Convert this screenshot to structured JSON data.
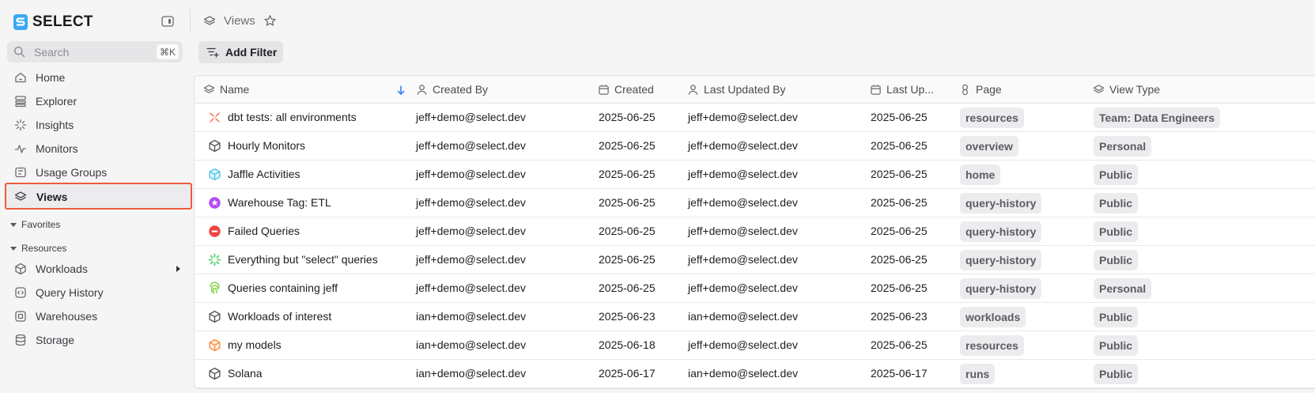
{
  "brand": {
    "name": "SELECT"
  },
  "sidebar": {
    "search": {
      "placeholder": "Search",
      "shortcut": "⌘K"
    },
    "items": [
      {
        "label": "Home",
        "icon": "home-icon"
      },
      {
        "label": "Explorer",
        "icon": "explorer-icon"
      },
      {
        "label": "Insights",
        "icon": "insights-icon"
      },
      {
        "label": "Monitors",
        "icon": "monitor-pulse-icon"
      },
      {
        "label": "Usage Groups",
        "icon": "usage-groups-icon"
      },
      {
        "label": "Views",
        "icon": "layers-icon",
        "active": true
      }
    ],
    "sections": {
      "favorites": "Favorites",
      "resources": "Resources"
    },
    "resources": [
      {
        "label": "Workloads",
        "icon": "cube-icon"
      },
      {
        "label": "Query History",
        "icon": "query-history-icon"
      },
      {
        "label": "Warehouses",
        "icon": "warehouse-icon"
      },
      {
        "label": "Storage",
        "icon": "database-icon"
      }
    ]
  },
  "header": {
    "title": "Views"
  },
  "toolbar": {
    "add_filter": "Add Filter"
  },
  "table": {
    "columns": {
      "name": "Name",
      "created_by": "Created By",
      "created": "Created",
      "last_updated_by": "Last Updated By",
      "last_updated": "Last Up...",
      "page": "Page",
      "view_type": "View Type"
    },
    "rows": [
      {
        "icon": "dbt-icon",
        "name": "dbt tests: all environments",
        "created_by": "jeff+demo@select.dev",
        "created": "2025-06-25",
        "last_updated_by": "jeff+demo@select.dev",
        "last_updated": "2025-06-25",
        "page": "resources",
        "view_type": "Team: Data Engineers"
      },
      {
        "icon": "cube-icon",
        "name": "Hourly Monitors",
        "created_by": "jeff+demo@select.dev",
        "created": "2025-06-25",
        "last_updated_by": "jeff+demo@select.dev",
        "last_updated": "2025-06-25",
        "page": "overview",
        "view_type": "Personal"
      },
      {
        "icon": "cube-cyan-icon",
        "name": "Jaffle Activities",
        "created_by": "jeff+demo@select.dev",
        "created": "2025-06-25",
        "last_updated_by": "jeff+demo@select.dev",
        "last_updated": "2025-06-25",
        "page": "home",
        "view_type": "Public"
      },
      {
        "icon": "star-badge-icon",
        "name": "Warehouse Tag: ETL",
        "created_by": "jeff+demo@select.dev",
        "created": "2025-06-25",
        "last_updated_by": "jeff+demo@select.dev",
        "last_updated": "2025-06-25",
        "page": "query-history",
        "view_type": "Public"
      },
      {
        "icon": "no-entry-icon",
        "name": "Failed Queries",
        "created_by": "jeff+demo@select.dev",
        "created": "2025-06-25",
        "last_updated_by": "jeff+demo@select.dev",
        "last_updated": "2025-06-25",
        "page": "query-history",
        "view_type": "Public"
      },
      {
        "icon": "spinner-icon",
        "name": "Everything but \"select\" queries",
        "created_by": "jeff+demo@select.dev",
        "created": "2025-06-25",
        "last_updated_by": "jeff+demo@select.dev",
        "last_updated": "2025-06-25",
        "page": "query-history",
        "view_type": "Public"
      },
      {
        "icon": "fingerprint-icon",
        "name": "Queries containing jeff",
        "created_by": "jeff+demo@select.dev",
        "created": "2025-06-25",
        "last_updated_by": "jeff+demo@select.dev",
        "last_updated": "2025-06-25",
        "page": "query-history",
        "view_type": "Personal"
      },
      {
        "icon": "cube-icon",
        "name": "Workloads of interest",
        "created_by": "ian+demo@select.dev",
        "created": "2025-06-23",
        "last_updated_by": "ian+demo@select.dev",
        "last_updated": "2025-06-23",
        "page": "workloads",
        "view_type": "Public"
      },
      {
        "icon": "cube-orange-icon",
        "name": "my models",
        "created_by": "ian+demo@select.dev",
        "created": "2025-06-18",
        "last_updated_by": "jeff+demo@select.dev",
        "last_updated": "2025-06-25",
        "page": "resources",
        "view_type": "Public"
      },
      {
        "icon": "cube-icon",
        "name": "Solana",
        "created_by": "ian+demo@select.dev",
        "created": "2025-06-17",
        "last_updated_by": "ian+demo@select.dev",
        "last_updated": "2025-06-17",
        "page": "runs",
        "view_type": "Public"
      }
    ]
  },
  "colors": {
    "accent": "#ef5a3c",
    "brand": "#3aa8f0",
    "dbt": "#ff694b",
    "cyan": "#4cc3e8",
    "purple": "#b44cf0",
    "red": "#ef4444",
    "green": "#4ccf6a",
    "lime": "#7bd13c",
    "orange": "#ff8a3d"
  }
}
